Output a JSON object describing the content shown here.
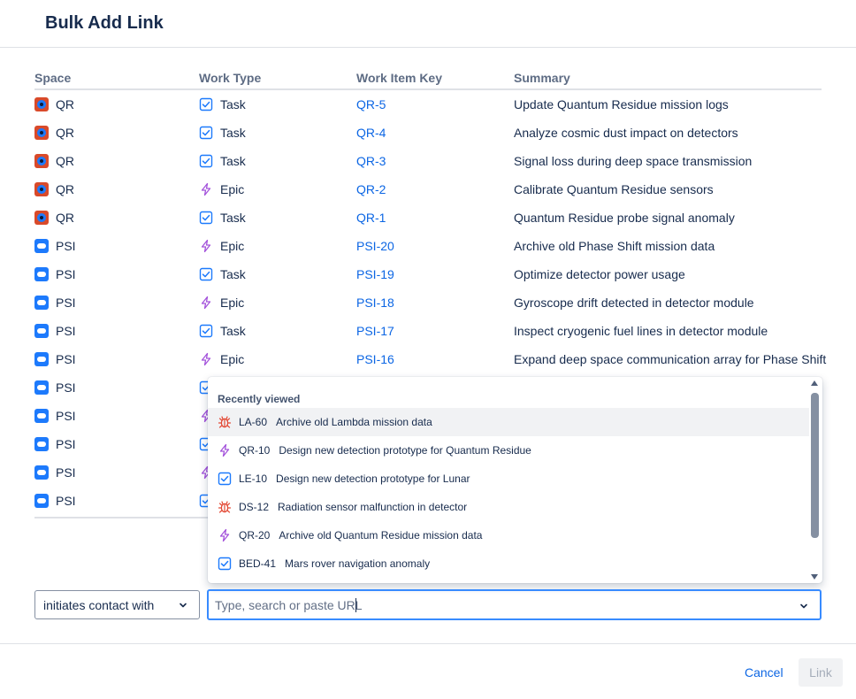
{
  "modal": {
    "title": "Bulk Add Link"
  },
  "table": {
    "headers": {
      "space": "Space",
      "work_type": "Work Type",
      "key": "Work Item Key",
      "summary": "Summary"
    },
    "rows": [
      {
        "space": "QR",
        "space_icon": "qr-project-icon",
        "type": "Task",
        "type_icon": "task-icon",
        "key": "QR-5",
        "summary": "Update Quantum Residue mission logs"
      },
      {
        "space": "QR",
        "space_icon": "qr-project-icon",
        "type": "Task",
        "type_icon": "task-icon",
        "key": "QR-4",
        "summary": "Analyze cosmic dust impact on detectors"
      },
      {
        "space": "QR",
        "space_icon": "qr-project-icon",
        "type": "Task",
        "type_icon": "task-icon",
        "key": "QR-3",
        "summary": "Signal loss during deep space transmission"
      },
      {
        "space": "QR",
        "space_icon": "qr-project-icon",
        "type": "Epic",
        "type_icon": "epic-icon",
        "key": "QR-2",
        "summary": "Calibrate Quantum Residue sensors"
      },
      {
        "space": "QR",
        "space_icon": "qr-project-icon",
        "type": "Task",
        "type_icon": "task-icon",
        "key": "QR-1",
        "summary": "Quantum Residue probe signal anomaly"
      },
      {
        "space": "PSI",
        "space_icon": "psi-project-icon",
        "type": "Epic",
        "type_icon": "epic-icon",
        "key": "PSI-20",
        "summary": "Archive old Phase Shift mission data"
      },
      {
        "space": "PSI",
        "space_icon": "psi-project-icon",
        "type": "Task",
        "type_icon": "task-icon",
        "key": "PSI-19",
        "summary": "Optimize detector power usage"
      },
      {
        "space": "PSI",
        "space_icon": "psi-project-icon",
        "type": "Epic",
        "type_icon": "epic-icon",
        "key": "PSI-18",
        "summary": "Gyroscope drift detected in detector module"
      },
      {
        "space": "PSI",
        "space_icon": "psi-project-icon",
        "type": "Task",
        "type_icon": "task-icon",
        "key": "PSI-17",
        "summary": "Inspect cryogenic fuel lines in detector module"
      },
      {
        "space": "PSI",
        "space_icon": "psi-project-icon",
        "type": "Epic",
        "type_icon": "epic-icon",
        "key": "PSI-16",
        "summary": "Expand deep space communication array for Phase Shift"
      },
      {
        "space": "PSI",
        "space_icon": "psi-project-icon",
        "type": "",
        "type_icon": "task-icon",
        "key": "",
        "summary": ""
      },
      {
        "space": "PSI",
        "space_icon": "psi-project-icon",
        "type": "",
        "type_icon": "epic-icon",
        "key": "",
        "summary": ""
      },
      {
        "space": "PSI",
        "space_icon": "psi-project-icon",
        "type": "",
        "type_icon": "task-icon",
        "key": "",
        "summary": ""
      },
      {
        "space": "PSI",
        "space_icon": "psi-project-icon",
        "type": "",
        "type_icon": "epic-icon",
        "key": "",
        "summary": ""
      },
      {
        "space": "PSI",
        "space_icon": "psi-project-icon",
        "type": "",
        "type_icon": "task-icon",
        "key": "",
        "summary": ""
      }
    ]
  },
  "dropdown": {
    "heading": "Recently viewed",
    "items": [
      {
        "key": "LA-60",
        "summary": "Archive old Lambda mission data",
        "icon": "bug-icon",
        "active": true
      },
      {
        "key": "QR-10",
        "summary": "Design new detection prototype for Quantum Residue",
        "icon": "epic-icon",
        "active": false
      },
      {
        "key": "LE-10",
        "summary": "Design new detection prototype for Lunar",
        "icon": "task-icon",
        "active": false
      },
      {
        "key": "DS-12",
        "summary": "Radiation sensor malfunction in detector",
        "icon": "bug-icon",
        "active": false
      },
      {
        "key": "QR-20",
        "summary": "Archive old Quantum Residue mission data",
        "icon": "epic-icon",
        "active": false
      },
      {
        "key": "BED-41",
        "summary": "Mars rover navigation anomaly",
        "icon": "task-icon",
        "active": false
      }
    ]
  },
  "controls": {
    "link_type": "initiates contact with",
    "search_placeholder": "Type, search or paste URL",
    "cancel_label": "Cancel",
    "link_label": "Link"
  },
  "colors": {
    "link": "#0c66e4",
    "task": "#1d7afc",
    "epic": "#a454db",
    "bug": "#e34935",
    "focus": "#388bff"
  }
}
